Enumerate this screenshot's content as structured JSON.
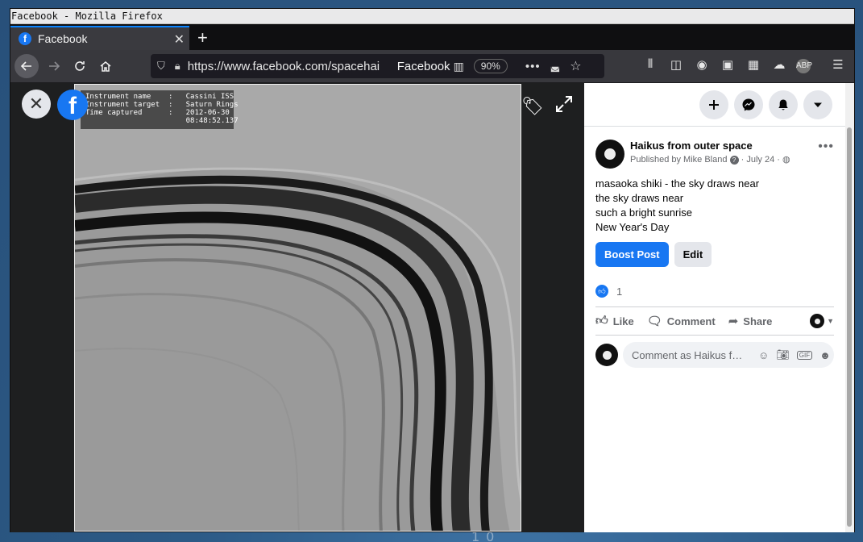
{
  "window": {
    "title": "Facebook - Mozilla Firefox"
  },
  "tabs": [
    {
      "label": "Facebook",
      "close": "✕"
    }
  ],
  "newtab": "+",
  "nav": {
    "url": "https://www.facebook.com/spacehai",
    "site_name": "Facebook",
    "zoom": "90%"
  },
  "viewer": {
    "meta_text": "Instrument name    :   Cassini ISS\nInstrument target  :   Saturn Rings\nTime captured      :   2012-06-30\n                       08:48:52.137",
    "close": "✕",
    "fb_letter": "f"
  },
  "post": {
    "page_name": "Haikus from outer space",
    "byline": "Published by Mike Bland",
    "date": "July 24",
    "poem": [
      "masaoka shiki - the sky draws near",
      "the sky draws near",
      "such a bright sunrise",
      "New Year's Day"
    ],
    "boost_label": "Boost Post",
    "edit_label": "Edit",
    "like_count": "1",
    "like_label": "Like",
    "comment_label": "Comment",
    "share_label": "Share",
    "comment_placeholder": "Comment as Haikus f…"
  },
  "desktop": {
    "deco": "10"
  },
  "colors": {
    "fb_blue": "#1877f2",
    "firefox_accent": "#0a84ff"
  }
}
